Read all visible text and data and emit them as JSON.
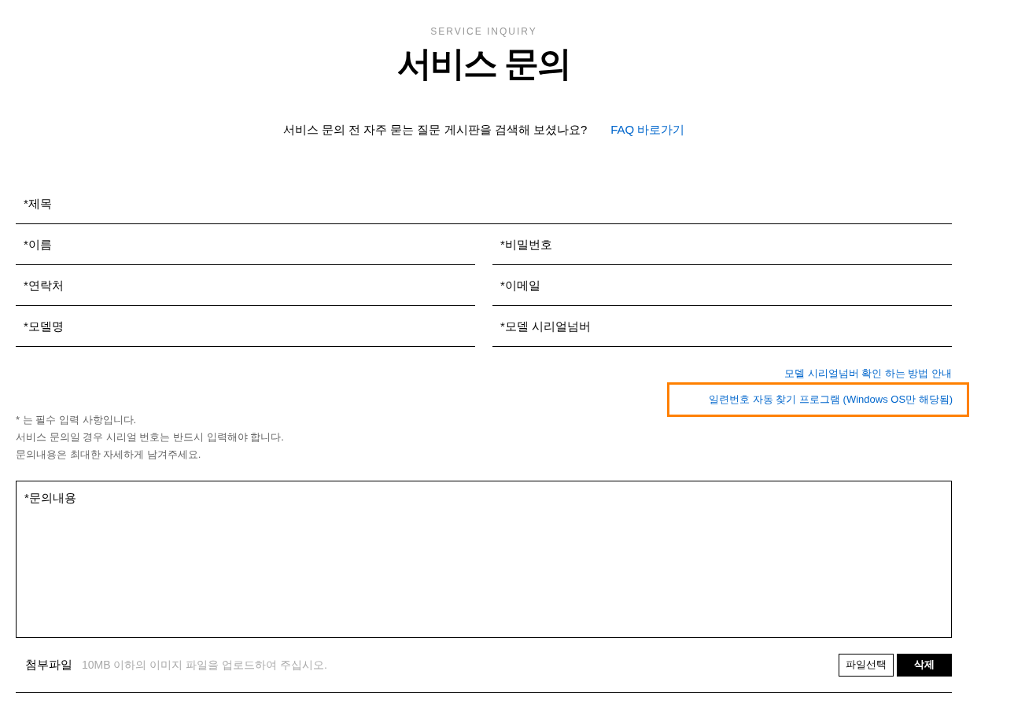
{
  "header": {
    "eyebrow": "SERVICE INQUIRY",
    "title": "서비스 문의"
  },
  "faq": {
    "question": "서비스 문의 전 자주 묻는 질문 게시판을 검색해 보셨나요?",
    "link": "FAQ 바로가기"
  },
  "form": {
    "title_field": {
      "placeholder": "*제목"
    },
    "rows": [
      [
        {
          "placeholder": "*이름"
        },
        {
          "placeholder": "*비밀번호"
        }
      ],
      [
        {
          "placeholder": "*연락처"
        },
        {
          "placeholder": "*이메일"
        }
      ],
      [
        {
          "placeholder": "*모델명"
        },
        {
          "placeholder": "*모델 시리얼넘버"
        }
      ]
    ],
    "help_links": [
      {
        "label": "모델 시리얼넘버 확인 하는 방법 안내",
        "highlighted": false
      },
      {
        "label": "일련번호 자동 찾기 프로그램 (Windows OS만 해당됨)",
        "highlighted": true
      }
    ],
    "notes": [
      "* 는 필수 입력 사항입니다.",
      "서비스 문의일 경우 시리얼 번호는 반드시 입력해야 합니다.",
      "문의내용은 최대한 자세하게 남겨주세요."
    ],
    "content": {
      "placeholder": "*문의내용"
    },
    "attachment": {
      "label": "첨부파일",
      "hint": "10MB 이하의 이미지 파일을 업로드하여 주십시오.",
      "buttons": [
        {
          "kind": "outline",
          "label": "파일선택"
        },
        {
          "kind": "solid",
          "label": "삭제"
        }
      ]
    }
  }
}
